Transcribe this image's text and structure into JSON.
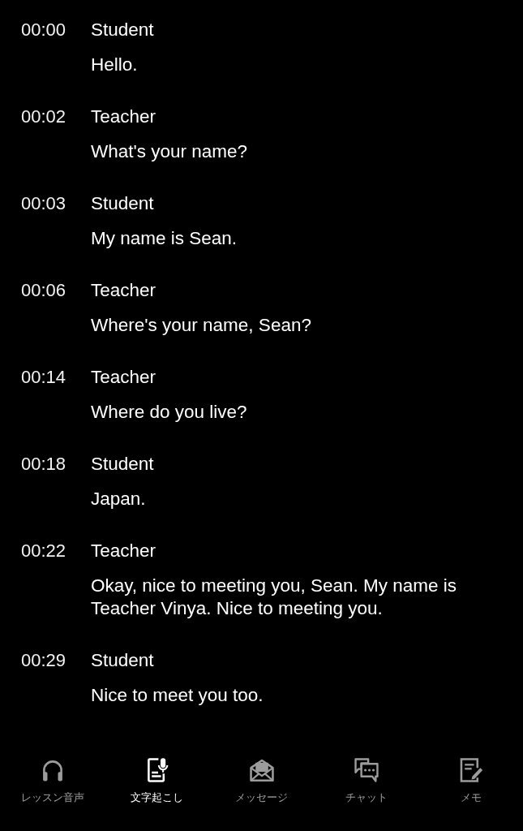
{
  "transcript": [
    {
      "time": "00:00",
      "speaker": "Student",
      "text": "Hello."
    },
    {
      "time": "00:02",
      "speaker": "Teacher",
      "text": "What's your name?"
    },
    {
      "time": "00:03",
      "speaker": "Student",
      "text": "My name is Sean."
    },
    {
      "time": "00:06",
      "speaker": "Teacher",
      "text": "Where's your name, Sean?"
    },
    {
      "time": "00:14",
      "speaker": "Teacher",
      "text": "Where do you live?"
    },
    {
      "time": "00:18",
      "speaker": "Student",
      "text": "Japan."
    },
    {
      "time": "00:22",
      "speaker": "Teacher",
      "text": "Okay, nice to meeting you, Sean. My name is Teacher Vinya. Nice to meeting you."
    },
    {
      "time": "00:29",
      "speaker": "Student",
      "text": "Nice to meet you too."
    }
  ],
  "nav": [
    {
      "label": "レッスン音声",
      "selected": false
    },
    {
      "label": "文字起こし",
      "selected": true
    },
    {
      "label": "メッセージ",
      "selected": false
    },
    {
      "label": "チャット",
      "selected": false
    },
    {
      "label": "メモ",
      "selected": false
    }
  ]
}
